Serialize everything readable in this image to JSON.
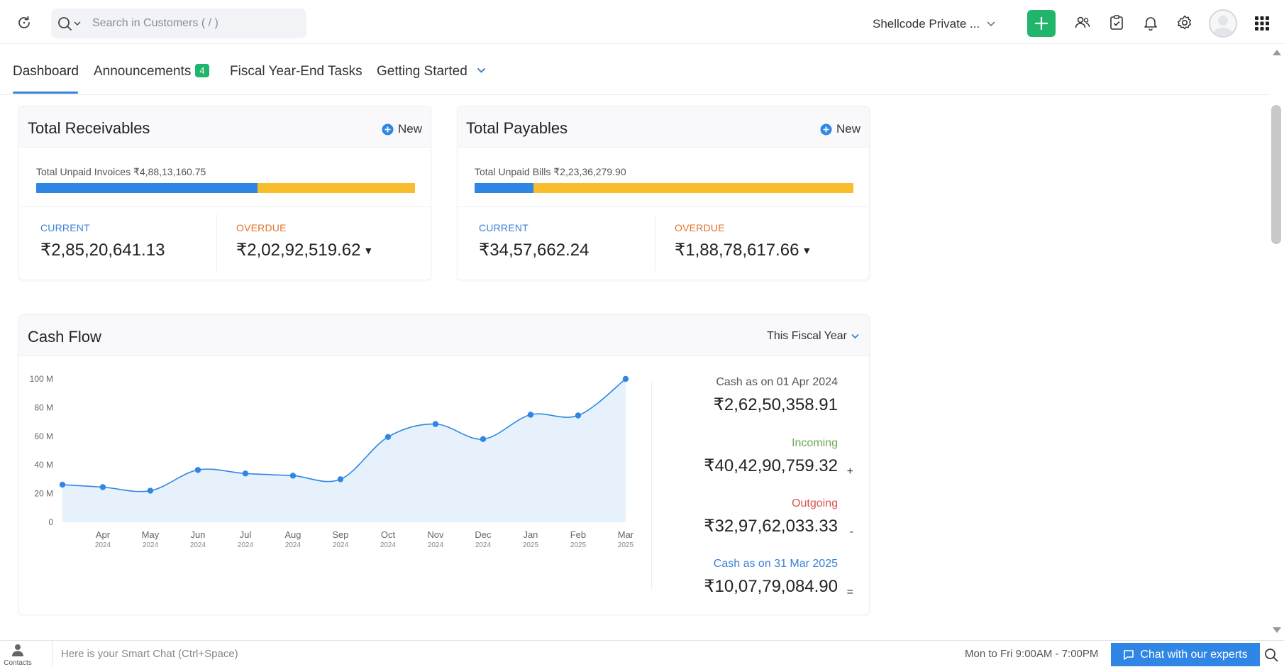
{
  "header": {
    "search_placeholder": "Search in Customers ( / )",
    "org_name": "Shellcode Private ..."
  },
  "tabs": [
    {
      "label": "Dashboard",
      "active": true
    },
    {
      "label": "Announcements",
      "badge": "4"
    },
    {
      "label": "Fiscal Year-End Tasks"
    },
    {
      "label": "Getting Started"
    }
  ],
  "receivables": {
    "title": "Total Receivables",
    "new_label": "New",
    "unpaid_text": "Total Unpaid Invoices ₹4,88,13,160.75",
    "current_fraction": 0.584,
    "current_label": "CURRENT",
    "current_value": "₹2,85,20,641.13",
    "overdue_label": "OVERDUE",
    "overdue_value": "₹2,02,92,519.62"
  },
  "payables": {
    "title": "Total Payables",
    "new_label": "New",
    "unpaid_text": "Total Unpaid Bills ₹2,23,36,279.90",
    "current_fraction": 0.155,
    "current_label": "CURRENT",
    "current_value": "₹34,57,662.24",
    "overdue_label": "OVERDUE",
    "overdue_value": "₹1,88,78,617.66"
  },
  "cashflow": {
    "title": "Cash Flow",
    "period": "This Fiscal Year",
    "opening_label": "Cash as on 01 Apr 2024",
    "opening_value": "₹2,62,50,358.91",
    "incoming_label": "Incoming",
    "incoming_value": "₹40,42,90,759.32",
    "incoming_op": "+",
    "outgoing_label": "Outgoing",
    "outgoing_value": "₹32,97,62,033.33",
    "outgoing_op": "-",
    "closing_label": "Cash as on 31 Mar 2025",
    "closing_value": "₹10,07,79,084.90",
    "closing_op": "="
  },
  "colors": {
    "accent_blue": "#2f86e4",
    "overdue_orange": "#f8bd2d",
    "current_label": "#3b82d6",
    "overdue_label": "#e0742a",
    "incoming_green": "#6aa84f",
    "outgoing_red": "#d9534f",
    "plus_green": "#21b56b"
  },
  "chart_data": {
    "type": "area",
    "categories": [
      "Apr 2024",
      "May 2024",
      "Jun 2024",
      "Jul 2024",
      "Aug 2024",
      "Sep 2024",
      "Oct 2024",
      "Nov 2024",
      "Dec 2024",
      "Jan 2025",
      "Feb 2025",
      "Mar 2025"
    ],
    "x_month_labels": [
      "Apr",
      "May",
      "Jun",
      "Jul",
      "Aug",
      "Sep",
      "Oct",
      "Nov",
      "Dec",
      "Jan",
      "Feb",
      "Mar"
    ],
    "x_year_labels": [
      "2024",
      "2024",
      "2024",
      "2024",
      "2024",
      "2024",
      "2024",
      "2024",
      "2024",
      "2025",
      "2025",
      "2025"
    ],
    "values": [
      26.2,
      24.5,
      22,
      36.5,
      34,
      32.5,
      30,
      59.5,
      68.5,
      58,
      75,
      74.5,
      100
    ],
    "values_note_start": "first value is the opening point at left edge",
    "y_ticks": [
      "0",
      "20 M",
      "40 M",
      "60 M",
      "80 M",
      "100 M"
    ],
    "ylim": [
      0,
      100
    ],
    "grid": false,
    "legend": "none"
  },
  "bottom": {
    "contacts_label": "Contacts",
    "smart_chat_placeholder": "Here is your Smart Chat (Ctrl+Space)",
    "hours": "Mon to Fri 9:00AM - 7:00PM",
    "chat_button": "Chat with our experts"
  }
}
